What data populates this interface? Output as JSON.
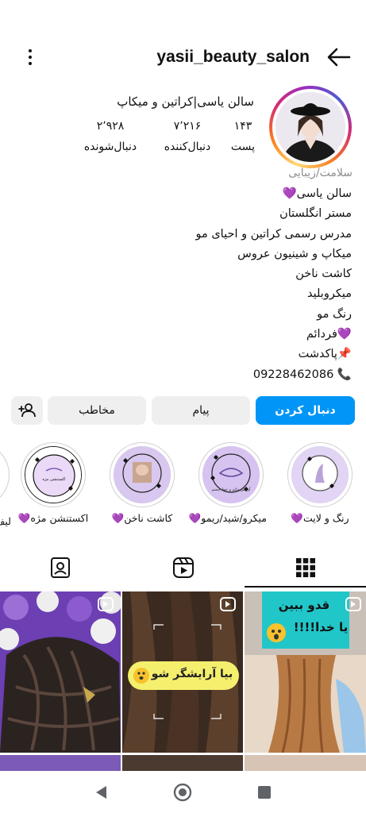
{
  "header": {
    "username": "yasii_beauty_salon"
  },
  "profile": {
    "name": "سالن یاسی|کراتین و میکاپ",
    "stats": [
      {
        "value": "۱۴۳",
        "label": "پست"
      },
      {
        "value": "۷٬۲۱۶",
        "label": "دنبال‌کننده"
      },
      {
        "value": "۲٬۹۲۸",
        "label": "دنبال‌شونده"
      }
    ],
    "category": "سلامت/زیبایی",
    "bio": [
      "سالن یاسی💜",
      "مستر انگلستان",
      "مدرس رسمی کراتین و احیای مو",
      "میکاپ و شینیون عروس",
      "کاشت ناخن",
      "میکروبلید",
      "رنگ مو",
      "💜فردائم",
      "📌پاکدشت"
    ],
    "phone": "09228462086 📞"
  },
  "buttons": {
    "follow": "دنبال کردن",
    "message": "پیام",
    "contact": "مخاطب"
  },
  "highlights": [
    {
      "label": "رنگ و لایت💜"
    },
    {
      "label": "میکرو/شید/ریمو💜"
    },
    {
      "label": "کاشت ناخن💜"
    },
    {
      "label": "اکستنشن مژه💜"
    },
    {
      "label": "لیف"
    }
  ],
  "highlight_texts": {
    "eyelash_title": "اکستنشن مژه",
    "micro_title": "آرایش دائم و خط چشم"
  },
  "posts": [
    {
      "overlay_line1": "قدو ببین",
      "overlay_line2": "یا خدا!!!!"
    },
    {
      "overlay_line1": "بیا آرایشگر شو"
    },
    {
      "overlay_line1": ""
    }
  ],
  "colors": {
    "accent": "#0095f6",
    "button_gray": "#efefef",
    "highlight_bg": "#ddd0f0",
    "category_gray": "#8e8e8e"
  },
  "icons": {
    "header_more": "more-vertical-icon",
    "header_back": "arrow-left-icon",
    "add_user": "person-add-icon",
    "tab_grid": "grid-icon",
    "tab_reels": "reels-icon",
    "tab_tagged": "tagged-icon",
    "nav_back": "triangle-back-icon",
    "nav_home": "circle-home-icon",
    "nav_recents": "square-recents-icon"
  }
}
